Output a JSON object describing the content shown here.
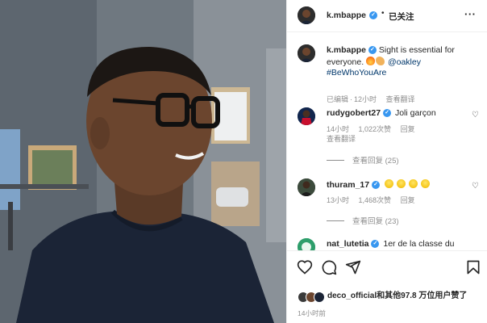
{
  "post": {
    "username": "k.mbappe",
    "follow_label": "已关注",
    "header_dot": "•",
    "more_label": "···"
  },
  "caption": {
    "username": "k.mbappe",
    "text_main": "Sight is essential for everyone.",
    "mention": "@oakley",
    "hashtag": "#BeWhoYouAre",
    "edited": "已编辑",
    "dot": "·",
    "time": "12小时",
    "translate": "查看翻译"
  },
  "comments": [
    {
      "username": "rudygobert27",
      "text": "Joli garçon",
      "time": "14小时",
      "likes": "1,022次赞",
      "reply": "回复",
      "translate": "查看翻译",
      "replies": "查看回复 (25)"
    },
    {
      "username": "thuram_17",
      "text": "",
      "time": "13小时",
      "likes": "1,468次赞",
      "reply": "回复",
      "replies": "查看回复 (23)"
    },
    {
      "username": "nat_lutetia",
      "text": "1er de la classe du"
    }
  ],
  "likes": {
    "user": "deco_official",
    "rest": "和其他97.8 万位用户赞了"
  },
  "timeago": "14小时前",
  "colors": {
    "verified": "#3897f0",
    "link": "#00376b",
    "muted": "#8e8e8e"
  }
}
